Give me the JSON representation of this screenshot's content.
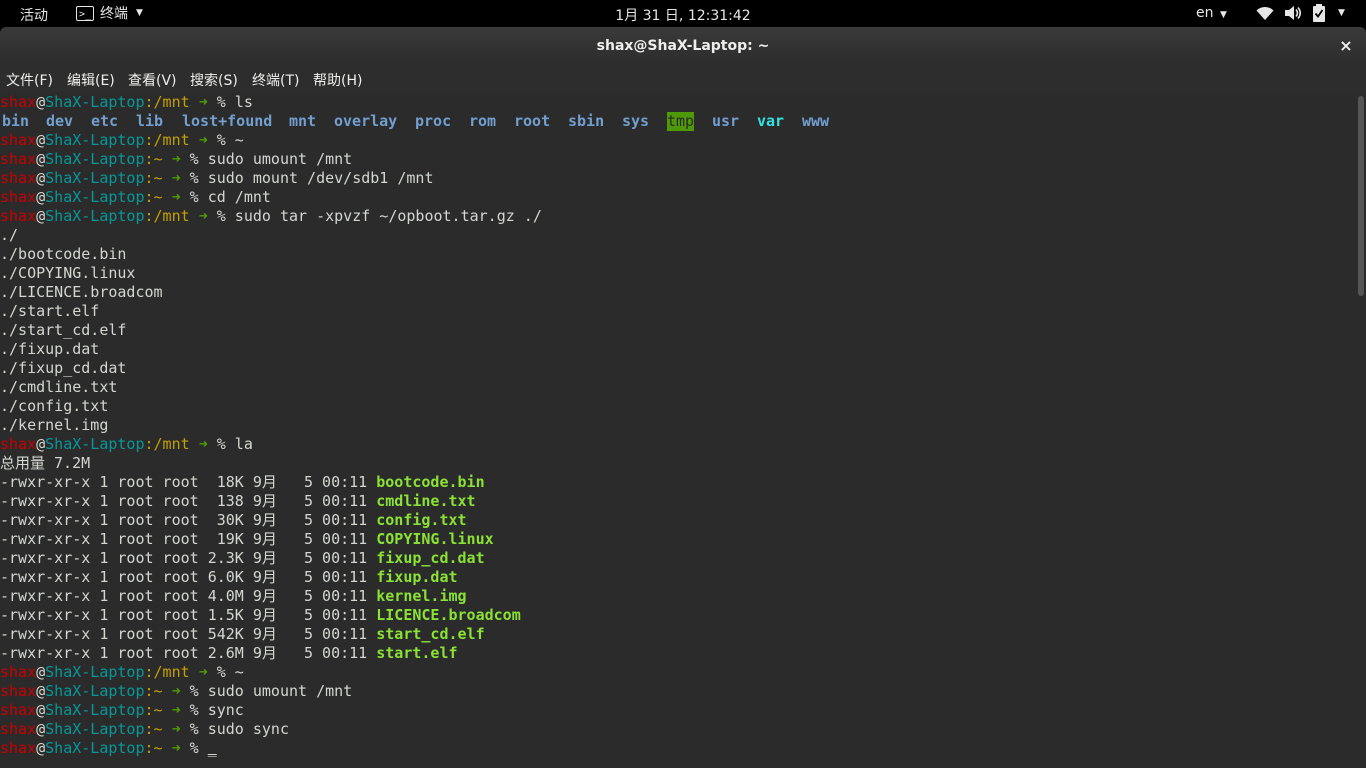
{
  "topbar": {
    "activities": "活动",
    "app_name": "终端",
    "clock": "1月 31 日, 12:31:42",
    "lang": "en"
  },
  "window": {
    "title": "shax@ShaX-Laptop: ~",
    "close": "×"
  },
  "menubar": {
    "items": [
      "文件(F)",
      "编辑(E)",
      "查看(V)",
      "搜索(S)",
      "终端(T)",
      "帮助(H)"
    ]
  },
  "prompt": {
    "user": "shax",
    "at": "@",
    "host": "ShaX-Laptop",
    "sep": ":",
    "arrow": "➜"
  },
  "terminal": {
    "lines": [
      {
        "type": "prompt",
        "path": "/mnt",
        "cmd": " % ls"
      },
      {
        "type": "ls",
        "items": [
          "bin",
          "dev",
          "etc",
          "lib",
          "lost+found",
          "mnt",
          "overlay",
          "proc",
          "rom",
          "root",
          "sbin",
          "sys",
          "tmp",
          "usr",
          "var",
          "www"
        ]
      },
      {
        "type": "prompt",
        "path": "/mnt",
        "cmd": " % ~"
      },
      {
        "type": "prompt",
        "path": "~",
        "cmd": " % sudo umount /mnt"
      },
      {
        "type": "prompt",
        "path": "~",
        "cmd": " % sudo mount /dev/sdb1 /mnt"
      },
      {
        "type": "prompt",
        "path": "~",
        "cmd": " % cd /mnt"
      },
      {
        "type": "prompt",
        "path": "/mnt",
        "cmd": " % sudo tar -xpvzf ~/opboot.tar.gz ./"
      },
      {
        "type": "text",
        "text": "./"
      },
      {
        "type": "text",
        "text": "./bootcode.bin"
      },
      {
        "type": "text",
        "text": "./COPYING.linux"
      },
      {
        "type": "text",
        "text": "./LICENCE.broadcom"
      },
      {
        "type": "text",
        "text": "./start.elf"
      },
      {
        "type": "text",
        "text": "./start_cd.elf"
      },
      {
        "type": "text",
        "text": "./fixup.dat"
      },
      {
        "type": "text",
        "text": "./fixup_cd.dat"
      },
      {
        "type": "text",
        "text": "./cmdline.txt"
      },
      {
        "type": "text",
        "text": "./config.txt"
      },
      {
        "type": "text",
        "text": "./kernel.img"
      },
      {
        "type": "prompt",
        "path": "/mnt",
        "cmd": " % la"
      },
      {
        "type": "text",
        "text": "总用量 7.2M"
      },
      {
        "type": "file",
        "meta": "-rwxr-xr-x 1 root root  18K 9月   5 00:11 ",
        "name": "bootcode.bin"
      },
      {
        "type": "file",
        "meta": "-rwxr-xr-x 1 root root  138 9月   5 00:11 ",
        "name": "cmdline.txt"
      },
      {
        "type": "file",
        "meta": "-rwxr-xr-x 1 root root  30K 9月   5 00:11 ",
        "name": "config.txt"
      },
      {
        "type": "file",
        "meta": "-rwxr-xr-x 1 root root  19K 9月   5 00:11 ",
        "name": "COPYING.linux"
      },
      {
        "type": "file",
        "meta": "-rwxr-xr-x 1 root root 2.3K 9月   5 00:11 ",
        "name": "fixup_cd.dat"
      },
      {
        "type": "file",
        "meta": "-rwxr-xr-x 1 root root 6.0K 9月   5 00:11 ",
        "name": "fixup.dat"
      },
      {
        "type": "file",
        "meta": "-rwxr-xr-x 1 root root 4.0M 9月   5 00:11 ",
        "name": "kernel.img"
      },
      {
        "type": "file",
        "meta": "-rwxr-xr-x 1 root root 1.5K 9月   5 00:11 ",
        "name": "LICENCE.broadcom"
      },
      {
        "type": "file",
        "meta": "-rwxr-xr-x 1 root root 542K 9月   5 00:11 ",
        "name": "start_cd.elf"
      },
      {
        "type": "file",
        "meta": "-rwxr-xr-x 1 root root 2.6M 9月   5 00:11 ",
        "name": "start.elf"
      },
      {
        "type": "prompt",
        "path": "/mnt",
        "cmd": " % ~"
      },
      {
        "type": "prompt",
        "path": "~",
        "cmd": " % sudo umount /mnt"
      },
      {
        "type": "prompt",
        "path": "~",
        "cmd": " % sync"
      },
      {
        "type": "prompt",
        "path": "~",
        "cmd": " % sudo sync"
      },
      {
        "type": "prompt",
        "path": "~",
        "cmd": " % ",
        "cursor": "_"
      }
    ]
  },
  "colors": {
    "user": "#cc0000",
    "host": "#06989a",
    "path": "#c4a000",
    "arrow": "#4e9a06",
    "dir": "#729fcf",
    "exe": "#8ae234",
    "background": "#2b2b2b"
  }
}
